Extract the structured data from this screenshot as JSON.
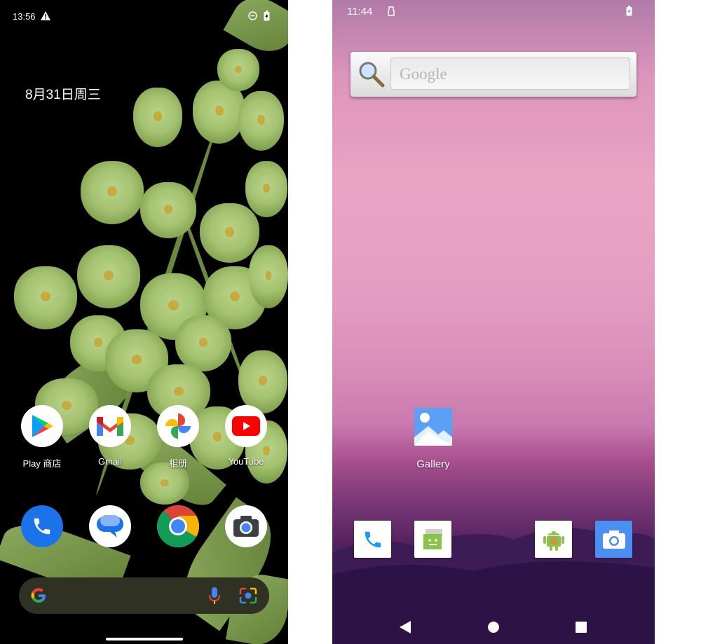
{
  "left_phone": {
    "status": {
      "time": "13:56"
    },
    "date_widget": "8月31日周三",
    "apps": [
      {
        "label": "Play 商店",
        "icon": "play-store-icon"
      },
      {
        "label": "Gmail",
        "icon": "gmail-icon"
      },
      {
        "label": "相册",
        "icon": "photos-icon"
      },
      {
        "label": "YouTube",
        "icon": "youtube-icon"
      }
    ],
    "dock": [
      {
        "icon": "phone-icon"
      },
      {
        "icon": "messages-icon"
      },
      {
        "icon": "chrome-icon"
      },
      {
        "icon": "camera-icon"
      }
    ],
    "search_bar": {
      "icons": [
        "google-g-icon",
        "microphone-icon",
        "lens-icon"
      ]
    }
  },
  "right_phone": {
    "status": {
      "time": "11:44"
    },
    "search_widget": {
      "placeholder": "Google"
    },
    "home_apps": [
      {
        "label": "Gallery",
        "icon": "gallery-icon"
      }
    ],
    "dock": [
      {
        "icon": "phone-icon"
      },
      {
        "icon": "messaging-icon"
      },
      {
        "icon": "android-icon"
      },
      {
        "icon": "camera-icon"
      }
    ],
    "nav": [
      "back-icon",
      "home-icon",
      "recents-icon"
    ]
  }
}
